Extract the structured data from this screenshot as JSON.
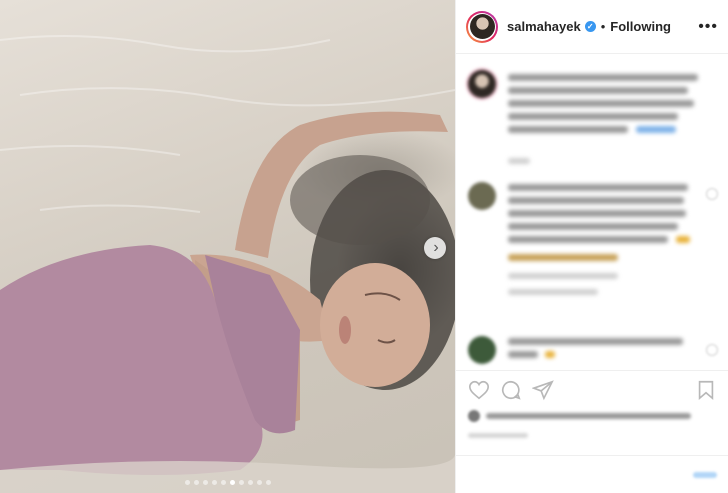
{
  "post": {
    "username": "salmahayek",
    "separator": "•",
    "follow_status": "Following",
    "more_label": "•••",
    "next_arrow": "›"
  },
  "carousel": {
    "total_slides": 10,
    "active_index": 5
  },
  "colors": {
    "verified_badge": "#3897f0",
    "link": "#3897f0",
    "swimsuit": "#b28aa0",
    "panel_border": "#efefef"
  },
  "icons": {
    "verified": "verified-badge-icon",
    "next": "chevron-right-icon",
    "like": "heart-icon",
    "comment": "speech-bubble-icon",
    "share": "share-icon",
    "save": "bookmark-icon",
    "more": "more-options-icon"
  }
}
